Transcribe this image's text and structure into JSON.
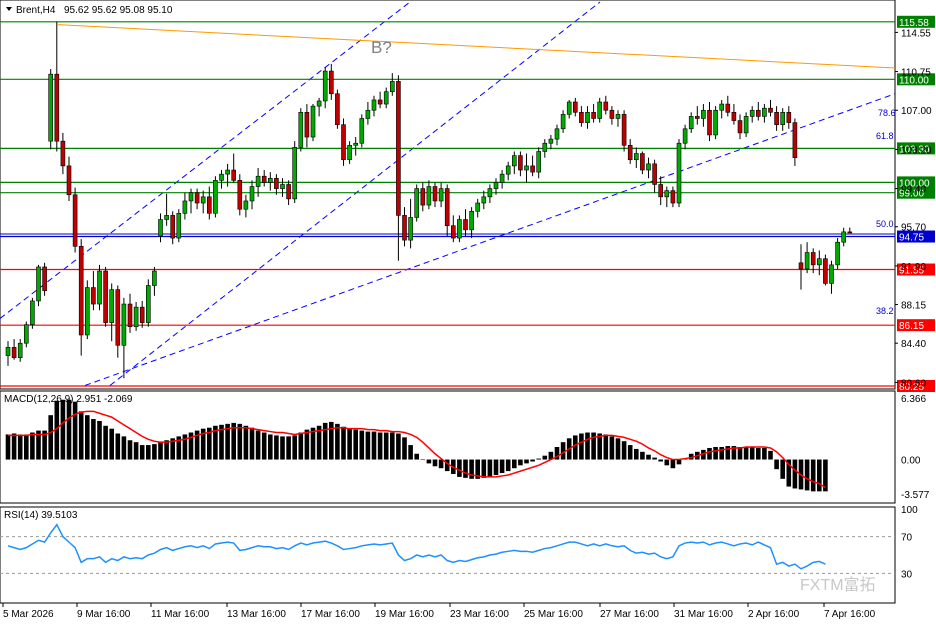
{
  "header": {
    "symbol_text": "Brent,H4",
    "ohlc_text": "95.62 95.62 95.08 95.10"
  },
  "annotations": {
    "wave_label": "B?"
  },
  "watermark": "FXTM富拓",
  "colors": {
    "up": "#00aa00",
    "down": "#c00000",
    "green_level": "#008000",
    "red_level": "#ff0000",
    "blue_level": "#0000cc",
    "trend": "#0000ff",
    "orange": "#ff9900",
    "macd_signal": "#ff0000",
    "rsi": "#1e90ff"
  },
  "chart_data": [
    {
      "type": "candlestick",
      "title": "Brent,H4",
      "ylim": [
        80.25,
        117.5
      ],
      "y_ticks": [
        "114.55",
        "110.75",
        "107.00",
        "103.20",
        "99.40",
        "95.70",
        "91.90",
        "88.15",
        "84.40",
        "80.60"
      ],
      "x_ticks": [
        "5 Mar 2026",
        "9 Mar 16:00",
        "11 Mar 16:00",
        "13 Mar 16:00",
        "17 Mar 16:00",
        "19 Mar 16:00",
        "23 Mar 16:00",
        "25 Mar 16:00",
        "27 Mar 16:00",
        "31 Mar 16:00",
        "2 Apr 16:00",
        "7 Apr 16:00"
      ],
      "levels": [
        {
          "value": 115.58,
          "label": "115.58",
          "color": "green"
        },
        {
          "value": 110.0,
          "label": "110.00",
          "color": "green"
        },
        {
          "value": 103.3,
          "label": "103.30",
          "color": "green"
        },
        {
          "value": 100.0,
          "label": "100.00",
          "color": "green"
        },
        {
          "value": 99.0,
          "label": "99.00",
          "color": "green"
        },
        {
          "value": 94.75,
          "label": "94.75",
          "color": "blue"
        },
        {
          "value": 91.55,
          "label": "91.55",
          "color": "red"
        },
        {
          "value": 86.15,
          "label": "86.15",
          "color": "red"
        },
        {
          "value": 80.25,
          "label": "80.25",
          "color": "red"
        }
      ],
      "fib_labels": [
        "78.6",
        "61.8",
        "50.0",
        "38.2"
      ],
      "candles": [
        [
          83.2,
          84.6,
          82.2,
          84.0
        ],
        [
          84.0,
          84.8,
          82.8,
          83.0
        ],
        [
          83.0,
          84.8,
          82.6,
          84.4
        ],
        [
          84.4,
          86.5,
          84.0,
          86.2
        ],
        [
          86.2,
          88.8,
          85.8,
          88.5
        ],
        [
          88.5,
          92.0,
          88.0,
          91.8
        ],
        [
          91.8,
          92.2,
          89.0,
          89.5
        ],
        [
          104.0,
          111.0,
          103.2,
          110.5
        ],
        [
          110.5,
          115.6,
          103.0,
          104.0
        ],
        [
          104.0,
          104.8,
          100.8,
          101.6
        ],
        [
          101.6,
          102.5,
          98.2,
          98.8
        ],
        [
          98.8,
          99.5,
          93.2,
          93.8
        ],
        [
          93.8,
          94.5,
          83.2,
          85.2
        ],
        [
          85.2,
          90.5,
          84.8,
          89.8
        ],
        [
          89.8,
          91.4,
          87.6,
          88.2
        ],
        [
          88.2,
          92.0,
          87.6,
          91.4
        ],
        [
          91.4,
          91.8,
          86.0,
          86.4
        ],
        [
          86.4,
          90.2,
          84.6,
          89.6
        ],
        [
          89.6,
          90.0,
          83.0,
          84.2
        ],
        [
          84.2,
          88.8,
          81.0,
          88.2
        ],
        [
          88.2,
          89.2,
          85.4,
          86.0
        ],
        [
          86.0,
          88.4,
          85.6,
          87.9
        ],
        [
          87.9,
          88.5,
          85.9,
          86.4
        ],
        [
          86.4,
          90.6,
          86.0,
          90.0
        ],
        [
          90.0,
          91.8,
          89.0,
          91.4
        ],
        [
          94.8,
          97.0,
          94.2,
          96.4
        ],
        [
          96.4,
          98.9,
          95.8,
          96.8
        ],
        [
          96.8,
          97.2,
          94.0,
          94.6
        ],
        [
          94.6,
          97.4,
          94.2,
          97.0
        ],
        [
          97.0,
          99.0,
          96.4,
          98.2
        ],
        [
          98.2,
          99.4,
          97.0,
          99.0
        ],
        [
          99.0,
          99.4,
          97.4,
          98.0
        ],
        [
          98.0,
          99.2,
          97.0,
          98.6
        ],
        [
          98.6,
          99.6,
          96.4,
          97.0
        ],
        [
          97.0,
          100.6,
          96.6,
          100.2
        ],
        [
          100.2,
          101.2,
          99.4,
          100.8
        ],
        [
          100.8,
          101.8,
          99.6,
          101.2
        ],
        [
          101.2,
          102.8,
          100.0,
          100.2
        ],
        [
          100.2,
          100.8,
          96.8,
          97.4
        ],
        [
          97.4,
          98.8,
          96.6,
          98.2
        ],
        [
          98.2,
          100.2,
          97.4,
          99.6
        ],
        [
          99.6,
          101.4,
          98.6,
          100.6
        ],
        [
          100.6,
          101.2,
          99.6,
          100.0
        ],
        [
          100.0,
          101.0,
          99.2,
          100.4
        ],
        [
          100.4,
          100.8,
          98.8,
          99.4
        ],
        [
          99.4,
          100.4,
          98.6,
          99.8
        ],
        [
          99.8,
          100.2,
          97.8,
          98.4
        ],
        [
          98.4,
          104.0,
          98.0,
          103.4
        ],
        [
          103.4,
          107.2,
          103.0,
          106.8
        ],
        [
          106.8,
          107.6,
          103.4,
          104.4
        ],
        [
          104.4,
          107.6,
          104.0,
          107.4
        ],
        [
          107.4,
          108.2,
          106.4,
          107.9
        ],
        [
          107.9,
          111.2,
          107.2,
          110.8
        ],
        [
          110.8,
          111.5,
          108.0,
          108.6
        ],
        [
          108.6,
          109.0,
          105.2,
          105.6
        ],
        [
          105.6,
          106.2,
          101.6,
          102.2
        ],
        [
          102.2,
          104.0,
          101.8,
          103.6
        ],
        [
          103.6,
          104.4,
          102.6,
          103.8
        ],
        [
          103.8,
          106.6,
          103.4,
          106.2
        ],
        [
          106.2,
          107.8,
          105.6,
          107.0
        ],
        [
          107.0,
          108.4,
          106.4,
          108.0
        ],
        [
          108.0,
          108.8,
          107.2,
          107.6
        ],
        [
          107.6,
          109.2,
          107.2,
          108.8
        ],
        [
          108.8,
          110.6,
          108.4,
          109.8
        ],
        [
          109.8,
          110.4,
          92.4,
          96.8
        ],
        [
          96.8,
          97.6,
          93.8,
          94.4
        ],
        [
          94.4,
          98.4,
          93.6,
          96.6
        ],
        [
          96.6,
          99.8,
          96.2,
          99.4
        ],
        [
          99.4,
          100.0,
          97.2,
          97.8
        ],
        [
          97.8,
          100.2,
          97.4,
          99.6
        ],
        [
          99.6,
          100.0,
          97.6,
          98.2
        ],
        [
          98.2,
          100.0,
          97.6,
          99.4
        ],
        [
          99.4,
          99.8,
          94.8,
          95.8
        ],
        [
          95.8,
          96.8,
          94.2,
          94.6
        ],
        [
          94.6,
          96.8,
          94.2,
          96.4
        ],
        [
          96.4,
          97.4,
          94.8,
          95.4
        ],
        [
          95.4,
          97.6,
          94.6,
          97.2
        ],
        [
          97.2,
          98.4,
          96.6,
          98.0
        ],
        [
          98.0,
          99.2,
          97.4,
          98.6
        ],
        [
          98.6,
          99.8,
          98.0,
          99.4
        ],
        [
          99.4,
          100.4,
          98.8,
          100.0
        ],
        [
          100.0,
          101.2,
          99.4,
          100.8
        ],
        [
          100.8,
          102.0,
          100.2,
          101.6
        ],
        [
          101.6,
          103.0,
          100.8,
          102.6
        ],
        [
          102.6,
          103.0,
          100.6,
          101.2
        ],
        [
          101.2,
          102.8,
          100.0,
          101.6
        ],
        [
          101.6,
          102.6,
          100.6,
          101.0
        ],
        [
          101.0,
          103.4,
          100.4,
          103.0
        ],
        [
          103.0,
          104.2,
          102.4,
          103.8
        ],
        [
          103.8,
          104.6,
          103.2,
          104.2
        ],
        [
          104.2,
          105.6,
          103.6,
          105.2
        ],
        [
          105.2,
          107.0,
          104.8,
          106.6
        ],
        [
          106.6,
          108.0,
          106.2,
          107.8
        ],
        [
          107.8,
          108.2,
          106.4,
          106.8
        ],
        [
          106.8,
          107.4,
          105.4,
          105.8
        ],
        [
          105.8,
          107.4,
          105.2,
          106.8
        ],
        [
          106.8,
          107.6,
          105.8,
          106.2
        ],
        [
          106.2,
          108.2,
          105.8,
          107.8
        ],
        [
          107.8,
          108.4,
          106.6,
          107.0
        ],
        [
          107.0,
          107.4,
          105.6,
          106.2
        ],
        [
          106.2,
          107.0,
          105.4,
          106.6
        ],
        [
          106.6,
          107.0,
          103.0,
          103.6
        ],
        [
          103.6,
          104.2,
          101.8,
          102.2
        ],
        [
          102.2,
          103.4,
          101.4,
          102.8
        ],
        [
          102.8,
          103.0,
          100.8,
          101.2
        ],
        [
          101.2,
          102.4,
          100.4,
          101.8
        ],
        [
          101.8,
          102.2,
          99.0,
          99.8
        ],
        [
          99.8,
          100.6,
          97.8,
          98.6
        ],
        [
          98.6,
          99.6,
          97.6,
          99.2
        ],
        [
          99.2,
          99.6,
          97.6,
          98.0
        ],
        [
          98.0,
          104.2,
          97.6,
          103.8
        ],
        [
          103.8,
          105.6,
          103.2,
          105.2
        ],
        [
          105.2,
          106.8,
          104.8,
          106.4
        ],
        [
          106.4,
          107.4,
          105.6,
          106.2
        ],
        [
          106.2,
          107.6,
          105.4,
          107.0
        ],
        [
          107.0,
          107.8,
          104.0,
          104.6
        ],
        [
          104.6,
          107.4,
          104.2,
          107.0
        ],
        [
          107.0,
          108.0,
          106.2,
          107.6
        ],
        [
          107.6,
          108.4,
          106.4,
          106.8
        ],
        [
          106.8,
          107.6,
          105.6,
          106.0
        ],
        [
          106.0,
          106.6,
          104.2,
          104.8
        ],
        [
          104.8,
          106.8,
          104.4,
          106.4
        ],
        [
          106.4,
          107.4,
          105.8,
          107.0
        ],
        [
          107.0,
          107.8,
          106.0,
          106.4
        ],
        [
          106.4,
          107.6,
          105.8,
          107.2
        ],
        [
          107.2,
          108.0,
          106.4,
          106.8
        ],
        [
          106.8,
          107.4,
          105.0,
          105.6
        ],
        [
          105.6,
          107.2,
          105.0,
          106.8
        ],
        [
          106.8,
          107.4,
          105.2,
          105.8
        ],
        [
          105.8,
          106.2,
          101.6,
          102.4
        ],
        [
          92.2,
          94.0,
          89.6,
          91.6
        ],
        [
          91.6,
          94.2,
          91.2,
          93.2
        ],
        [
          93.2,
          93.6,
          91.2,
          92.0
        ],
        [
          92.0,
          93.4,
          91.0,
          92.6
        ],
        [
          92.6,
          93.0,
          90.0,
          90.2
        ],
        [
          90.2,
          92.4,
          89.2,
          92.0
        ],
        [
          92.0,
          94.6,
          91.6,
          94.2
        ],
        [
          94.2,
          95.6,
          93.8,
          95.2
        ],
        [
          95.2,
          95.62,
          95.08,
          95.1
        ]
      ]
    },
    {
      "type": "bar",
      "title": "MACD(12,26,9) 2.951 -2.069",
      "ylim": [
        -4.3,
        6.9
      ],
      "y_ticks": [
        "6.366",
        "0.00",
        "-3.577"
      ],
      "histogram": [
        2.6,
        2.7,
        2.6,
        2.6,
        2.8,
        3.0,
        3.0,
        4.6,
        6.1,
        6.2,
        6.2,
        6.0,
        5.0,
        4.6,
        4.2,
        4.0,
        3.5,
        3.2,
        2.7,
        2.4,
        2.0,
        1.8,
        1.5,
        1.5,
        1.6,
        1.8,
        2.0,
        2.2,
        2.4,
        2.6,
        2.8,
        3.0,
        3.2,
        3.3,
        3.5,
        3.6,
        3.7,
        3.8,
        3.7,
        3.5,
        3.3,
        3.0,
        2.8,
        2.6,
        2.5,
        2.4,
        2.4,
        2.5,
        2.8,
        3.1,
        3.3,
        3.5,
        3.8,
        3.9,
        3.7,
        3.4,
        3.2,
        3.1,
        3.0,
        2.9,
        2.9,
        2.8,
        2.8,
        2.8,
        2.7,
        2.3,
        1.5,
        0.6,
        0.0,
        -0.4,
        -0.7,
        -0.9,
        -1.2,
        -1.5,
        -1.8,
        -1.9,
        -2.0,
        -2.0,
        -1.9,
        -1.8,
        -1.6,
        -1.4,
        -1.2,
        -0.9,
        -0.6,
        -0.4,
        -0.2,
        0.1,
        0.4,
        0.8,
        1.3,
        1.8,
        2.2,
        2.5,
        2.7,
        2.8,
        2.8,
        2.7,
        2.6,
        2.4,
        2.2,
        1.9,
        1.5,
        1.1,
        0.8,
        0.5,
        0.2,
        -0.2,
        -0.6,
        -0.9,
        -0.5,
        0.1,
        0.6,
        0.8,
        1.0,
        1.2,
        1.3,
        1.3,
        1.4,
        1.4,
        1.3,
        1.3,
        1.3,
        1.2,
        1.2,
        0.9,
        -1.0,
        -2.0,
        -2.8,
        -3.0,
        -3.1,
        -3.2,
        -3.3,
        -3.3,
        -3.3
      ],
      "signal": [
        2.5,
        2.5,
        2.5,
        2.5,
        2.6,
        2.6,
        2.6,
        2.8,
        3.2,
        3.8,
        4.3,
        4.7,
        4.9,
        5.0,
        5.0,
        4.8,
        4.6,
        4.4,
        4.0,
        3.6,
        3.2,
        2.8,
        2.4,
        2.1,
        1.9,
        1.8,
        1.8,
        1.9,
        2.0,
        2.1,
        2.3,
        2.5,
        2.7,
        2.8,
        3.0,
        3.1,
        3.2,
        3.3,
        3.3,
        3.3,
        3.2,
        3.1,
        3.0,
        2.9,
        2.8,
        2.8,
        2.7,
        2.6,
        2.7,
        2.8,
        2.9,
        3.0,
        3.1,
        3.2,
        3.3,
        3.3,
        3.2,
        3.2,
        3.2,
        3.1,
        3.1,
        3.0,
        3.0,
        2.9,
        2.9,
        2.8,
        2.6,
        2.3,
        1.8,
        1.2,
        0.6,
        0.1,
        -0.4,
        -0.8,
        -1.1,
        -1.4,
        -1.6,
        -1.7,
        -1.8,
        -1.8,
        -1.8,
        -1.7,
        -1.6,
        -1.4,
        -1.2,
        -1.0,
        -0.8,
        -0.6,
        -0.3,
        0.0,
        0.3,
        0.7,
        1.1,
        1.5,
        1.8,
        2.1,
        2.3,
        2.4,
        2.5,
        2.5,
        2.4,
        2.3,
        2.1,
        1.9,
        1.6,
        1.2,
        0.9,
        0.5,
        0.2,
        0.0,
        0.0,
        0.1,
        0.2,
        0.4,
        0.6,
        0.8,
        0.9,
        1.0,
        1.1,
        1.2,
        1.2,
        1.3,
        1.3,
        1.3,
        1.3,
        1.2,
        0.8,
        0.2,
        -0.5,
        -1.1,
        -1.6,
        -2.0,
        -2.3,
        -2.5,
        -2.9
      ]
    },
    {
      "type": "line",
      "title": "RSI(14) 39.5103",
      "ylim": [
        0,
        100
      ],
      "y_ticks": [
        "100",
        "70",
        "30",
        "0"
      ],
      "values": [
        60,
        58,
        56,
        58,
        62,
        66,
        64,
        74,
        83,
        70,
        64,
        58,
        42,
        46,
        46,
        48,
        42,
        46,
        44,
        48,
        46,
        47,
        46,
        50,
        52,
        56,
        58,
        55,
        57,
        59,
        60,
        58,
        60,
        57,
        62,
        63,
        64,
        63,
        55,
        56,
        58,
        60,
        59,
        59,
        57,
        58,
        56,
        60,
        63,
        61,
        63,
        64,
        65,
        63,
        60,
        56,
        57,
        58,
        60,
        61,
        62,
        61,
        62,
        63,
        50,
        44,
        46,
        50,
        48,
        50,
        48,
        50,
        44,
        42,
        44,
        43,
        45,
        47,
        48,
        50,
        51,
        53,
        54,
        55,
        54,
        54,
        53,
        55,
        57,
        58,
        60,
        62,
        64,
        64,
        62,
        60,
        62,
        60,
        62,
        60,
        59,
        60,
        55,
        52,
        53,
        51,
        52,
        48,
        46,
        48,
        60,
        63,
        64,
        63,
        64,
        61,
        63,
        64,
        62,
        60,
        62,
        63,
        61,
        64,
        61,
        58,
        40,
        42,
        38,
        40,
        35,
        38,
        42,
        43,
        40
      ]
    }
  ]
}
